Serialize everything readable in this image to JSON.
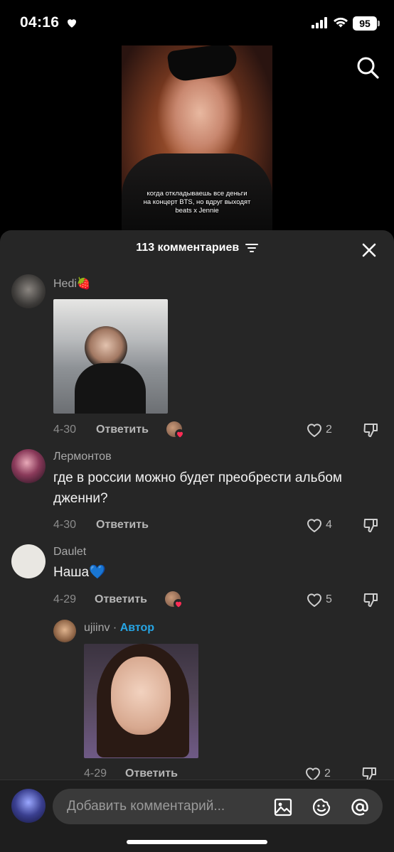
{
  "status_bar": {
    "time": "04:16",
    "battery": "95"
  },
  "video": {
    "caption": "когда откладываешь все деньги на концерт BTS, но вдруг выходят beats x Jennie"
  },
  "sheet": {
    "title": "113 комментариев"
  },
  "comments": [
    {
      "user": "Hedi🍓",
      "text": "",
      "date": "4-30",
      "reply": "Ответить",
      "likes": "2"
    },
    {
      "user": "Лермонтов",
      "text": "где в россии можно будет преобрести альбом дженни?",
      "date": "4-30",
      "reply": "Ответить",
      "likes": "4"
    },
    {
      "user": "Daulet",
      "text": "Наша💙",
      "date": "4-29",
      "reply": "Ответить",
      "likes": "5"
    }
  ],
  "reply_comment": {
    "user": "ujiinv",
    "separator": " · ",
    "author_tag": "Автор",
    "date": "4-29",
    "reply": "Ответить",
    "likes": "2"
  },
  "composer": {
    "placeholder": "Добавить комментарий..."
  },
  "icons": [
    "heart-icon",
    "signal-icon",
    "wifi-icon",
    "battery-icon",
    "search-icon",
    "filter-icon",
    "close-icon",
    "like-icon",
    "dislike-icon",
    "image-icon",
    "emoji-icon",
    "mention-icon"
  ],
  "colors": {
    "sheet_bg": "#262626",
    "author_accent": "#26a5e4",
    "reaction_heart": "#fe2c55"
  }
}
